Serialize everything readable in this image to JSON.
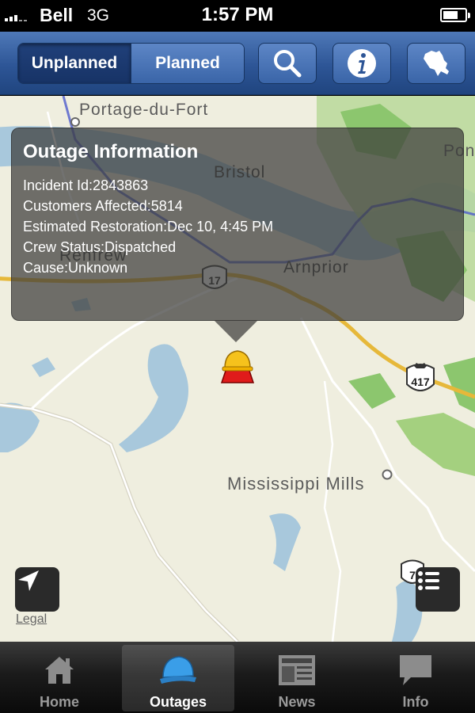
{
  "status_bar": {
    "carrier": "Bell",
    "network": "3G",
    "time": "1:57 PM",
    "battery_level": 0.7
  },
  "toolbar": {
    "segments": [
      {
        "label": "Unplanned",
        "selected": true
      },
      {
        "label": "Planned",
        "selected": false
      }
    ],
    "buttons": [
      "search-icon",
      "info-icon",
      "ontario-map-icon"
    ],
    "accent_color": "#2d5596"
  },
  "map": {
    "places": [
      "Portage-du-Fort",
      "Bristol",
      "Renfrew",
      "Arnprior",
      "Mississippi Mills",
      "Pon"
    ],
    "highway_shields": [
      "17",
      "417",
      "7"
    ],
    "legal": "Legal"
  },
  "outage_popup": {
    "title": "Outage Information",
    "incident_id": "Incident Id:2843863",
    "customers_affected": "Customers Affected:5814",
    "estimated_restoration": "Estimated Restoration:Dec 10, 4:45 PM",
    "crew_status": "Crew Status:Dispatched",
    "cause": "Cause:Unknown"
  },
  "tabs": [
    {
      "label": "Home",
      "icon": "house-icon",
      "selected": false
    },
    {
      "label": "Outages",
      "icon": "hardhat-icon",
      "selected": true
    },
    {
      "label": "News",
      "icon": "newspaper-icon",
      "selected": false
    },
    {
      "label": "Info",
      "icon": "speech-bubble-icon",
      "selected": false
    }
  ]
}
